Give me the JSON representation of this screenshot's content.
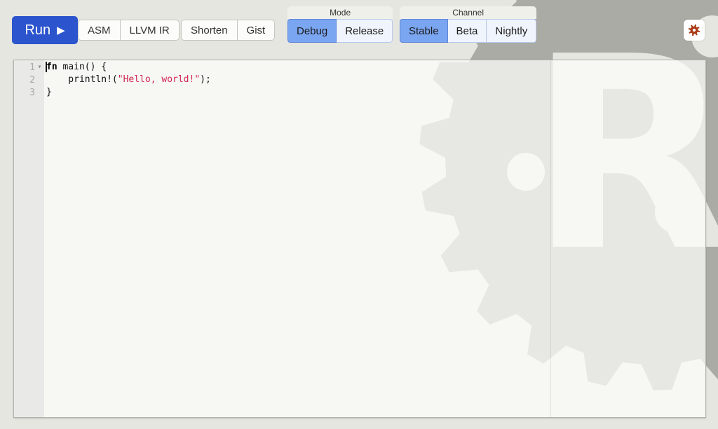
{
  "toolbar": {
    "run_label": "Run",
    "output_buttons": [
      "ASM",
      "LLVM IR"
    ],
    "share_buttons": [
      "Shorten",
      "Gist"
    ],
    "mode": {
      "legend": "Mode",
      "options": [
        {
          "label": "Debug",
          "selected": true
        },
        {
          "label": "Release",
          "selected": false
        }
      ]
    },
    "channel": {
      "legend": "Channel",
      "options": [
        {
          "label": "Stable",
          "selected": true
        },
        {
          "label": "Beta",
          "selected": false
        },
        {
          "label": "Nightly",
          "selected": false
        }
      ]
    }
  },
  "icons": {
    "run_play": "▶",
    "fold": "▾",
    "settings": "gear-icon",
    "watermark": "rust-logo"
  },
  "editor": {
    "lines": [
      {
        "number": "1",
        "fold": true,
        "tokens": [
          {
            "text": "fn",
            "style": "keyword"
          },
          {
            "text": " main() {",
            "style": "plain"
          }
        ]
      },
      {
        "number": "2",
        "fold": false,
        "tokens": [
          {
            "text": "    println!(",
            "style": "plain"
          },
          {
            "text": "\"Hello, world!\"",
            "style": "string"
          },
          {
            "text": ");",
            "style": "plain"
          }
        ]
      },
      {
        "number": "3",
        "fold": false,
        "tokens": [
          {
            "text": "}",
            "style": "plain"
          }
        ]
      }
    ]
  },
  "colors": {
    "page_bg": "#e6e6e0",
    "logo_gray": "#ababa6",
    "run_blue": "#2b54cd",
    "selected_blue": "#7aa5f0",
    "selected_border": "#5f87d8",
    "unselected_bg": "#f0f5fd",
    "unselected_border": "#b7c8ea",
    "button_bg": "#fcfcfa",
    "button_border": "#c6c6c1",
    "legend_bg": "#f0f0eb",
    "gutter_bg": "#e9e9e8",
    "gutter_text": "#aaaaaa",
    "string_color": "#d1244f",
    "settings_icon": "#a93b16"
  }
}
